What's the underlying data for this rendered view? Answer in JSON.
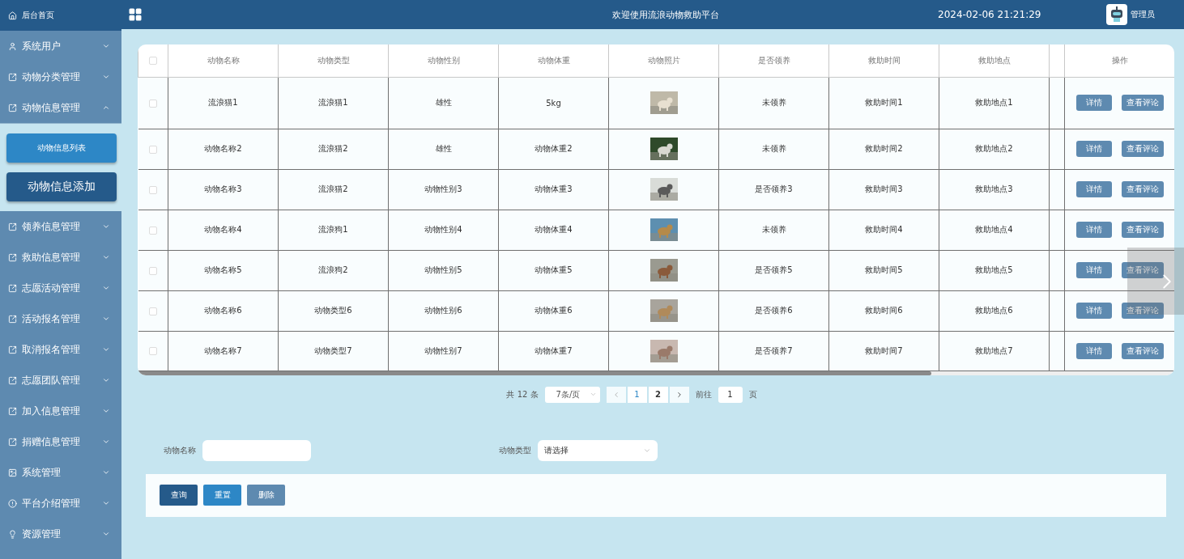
{
  "sidebar": {
    "home": "后台首页",
    "menu": [
      {
        "label": "系统用户",
        "expanded": false
      },
      {
        "label": "动物分类管理",
        "expanded": false
      },
      {
        "label": "动物信息管理",
        "expanded": true,
        "children": [
          {
            "label": "动物信息列表",
            "selected": false
          },
          {
            "label": "动物信息添加",
            "selected": true
          }
        ]
      },
      {
        "label": "领养信息管理",
        "expanded": false
      },
      {
        "label": "救助信息管理",
        "expanded": false
      },
      {
        "label": "志愿活动管理",
        "expanded": false
      },
      {
        "label": "活动报名管理",
        "expanded": false
      },
      {
        "label": "取消报名管理",
        "expanded": false
      },
      {
        "label": "志愿团队管理",
        "expanded": false
      },
      {
        "label": "加入信息管理",
        "expanded": false
      },
      {
        "label": "捐赠信息管理",
        "expanded": false
      },
      {
        "label": "系统管理",
        "expanded": false
      },
      {
        "label": "平台介绍管理",
        "expanded": false
      },
      {
        "label": "资源管理",
        "expanded": false
      }
    ]
  },
  "header": {
    "title": "欢迎使用流浪动物救助平台",
    "datetime": "2024-02-06 21:21:29",
    "user": "管理员"
  },
  "table": {
    "header_checked": false,
    "columns": [
      "动物名称",
      "动物类型",
      "动物性别",
      "动物体重",
      "动物照片",
      "是否领养",
      "救助时间",
      "救助地点"
    ],
    "action_column": "操作",
    "rows": [
      {
        "checked": false,
        "cells": [
          "流浪猫1",
          "流浪猫1",
          "雄性",
          "5kg",
          {
            "kind": "picture"
          },
          "未领养",
          "救助时间1",
          "救助地点1"
        ],
        "actions": [
          "详情",
          "查看评论"
        ]
      },
      {
        "checked": false,
        "cells": [
          "动物名称2",
          "流浪猫2",
          "雄性",
          "动物体重2",
          {
            "kind": "picture"
          },
          "未领养",
          "救助时间2",
          "救助地点2"
        ],
        "actions": [
          "详情",
          "查看评论"
        ]
      },
      {
        "checked": false,
        "cells": [
          "动物名称3",
          "流浪猫2",
          "动物性别3",
          "动物体重3",
          {
            "kind": "picture"
          },
          "是否领养3",
          "救助时间3",
          "救助地点3"
        ],
        "actions": [
          "详情",
          "查看评论"
        ]
      },
      {
        "checked": false,
        "cells": [
          "动物名称4",
          "流浪狗1",
          "动物性别4",
          "动物体重4",
          {
            "kind": "picture"
          },
          "未领养",
          "救助时间4",
          "救助地点4"
        ],
        "actions": [
          "详情",
          "查看评论"
        ]
      },
      {
        "checked": false,
        "cells": [
          "动物名称5",
          "流浪狗2",
          "动物性别5",
          "动物体重5",
          {
            "kind": "picture"
          },
          "是否领养5",
          "救助时间5",
          "救助地点5"
        ],
        "actions": [
          "详情",
          "查看评论"
        ]
      },
      {
        "checked": false,
        "cells": [
          "动物名称6",
          "动物类型6",
          "动物性别6",
          "动物体重6",
          {
            "kind": "picture"
          },
          "是否领养6",
          "救助时间6",
          "救助地点6"
        ],
        "actions": [
          "详情",
          "查看评论"
        ]
      },
      {
        "checked": false,
        "cells": [
          "动物名称7",
          "动物类型7",
          "动物性别7",
          "动物体重7",
          {
            "kind": "picture"
          },
          "是否领养7",
          "救助时间7",
          "救助地点7"
        ],
        "actions": [
          "详情",
          "查看评论"
        ]
      }
    ]
  },
  "pagination": {
    "total": "共 12 条",
    "page_size": "7条/页",
    "pages": [
      {
        "label": "1",
        "selected": true
      },
      {
        "label": "2",
        "selected": false
      }
    ],
    "goto_label": "前往",
    "goto_value": "1",
    "goto_suffix": "页"
  },
  "search": {
    "fields": [
      {
        "kind": "input",
        "label": "动物名称"
      },
      {
        "kind": "select",
        "label": "动物类型",
        "placeholder": "请选择"
      }
    ],
    "buttons": [
      {
        "kind": "primary",
        "label": "查询"
      },
      {
        "kind": "secondary",
        "label": "重置"
      },
      {
        "kind": "danger",
        "label": "删除"
      }
    ]
  }
}
